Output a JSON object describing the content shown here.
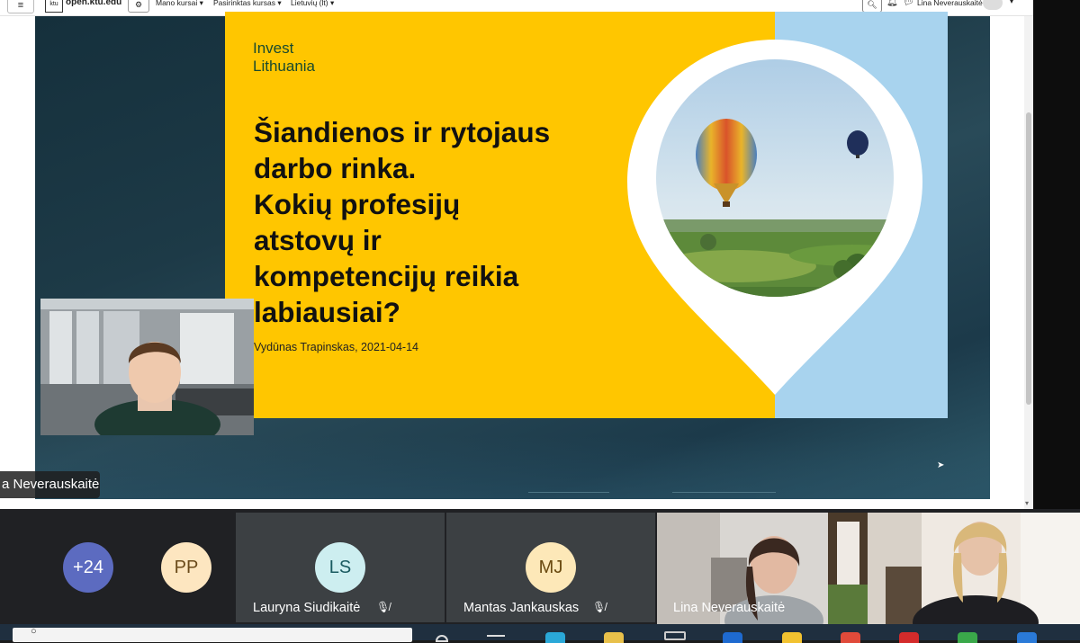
{
  "browser_nav": {
    "menu_icon": "hamburger-icon",
    "logo_text": "ktu",
    "site": "open.ktu.edu",
    "menus": [
      "Mano kursai",
      "Pasirinktas kursas",
      "Lietuvių (lt)"
    ],
    "user": "Lina Neverauskaitė"
  },
  "slide": {
    "brand_line1": "Invest",
    "brand_line2": "Lithuania",
    "title_lines": [
      "Šiandienos ir rytojaus",
      "darbo rinka.",
      "Kokių profesijų",
      "atstovų ir",
      "kompetencijų reikia",
      "labiausiai?"
    ],
    "author": "Vydūnas Trapinskas, 2021-04-14"
  },
  "speaker_label": "a Neverauskaitė",
  "participants": {
    "overflow_count": "+24",
    "pp_initials": "PP",
    "ls_initials": "LS",
    "ls_name": "Lauryna Siudikaitė",
    "mj_initials": "MJ",
    "mj_name": "Mantas Jankauskas",
    "cam1_name": "Lina Neverauskaitė"
  },
  "colors": {
    "slide_yellow": "#ffc600",
    "slide_blue": "#a8d3ee",
    "avatar_purple": "#5c6bc0",
    "avatar_peach": "#fde6c0",
    "avatar_teal": "#cdeef0",
    "avatar_cream": "#fde8b8"
  }
}
